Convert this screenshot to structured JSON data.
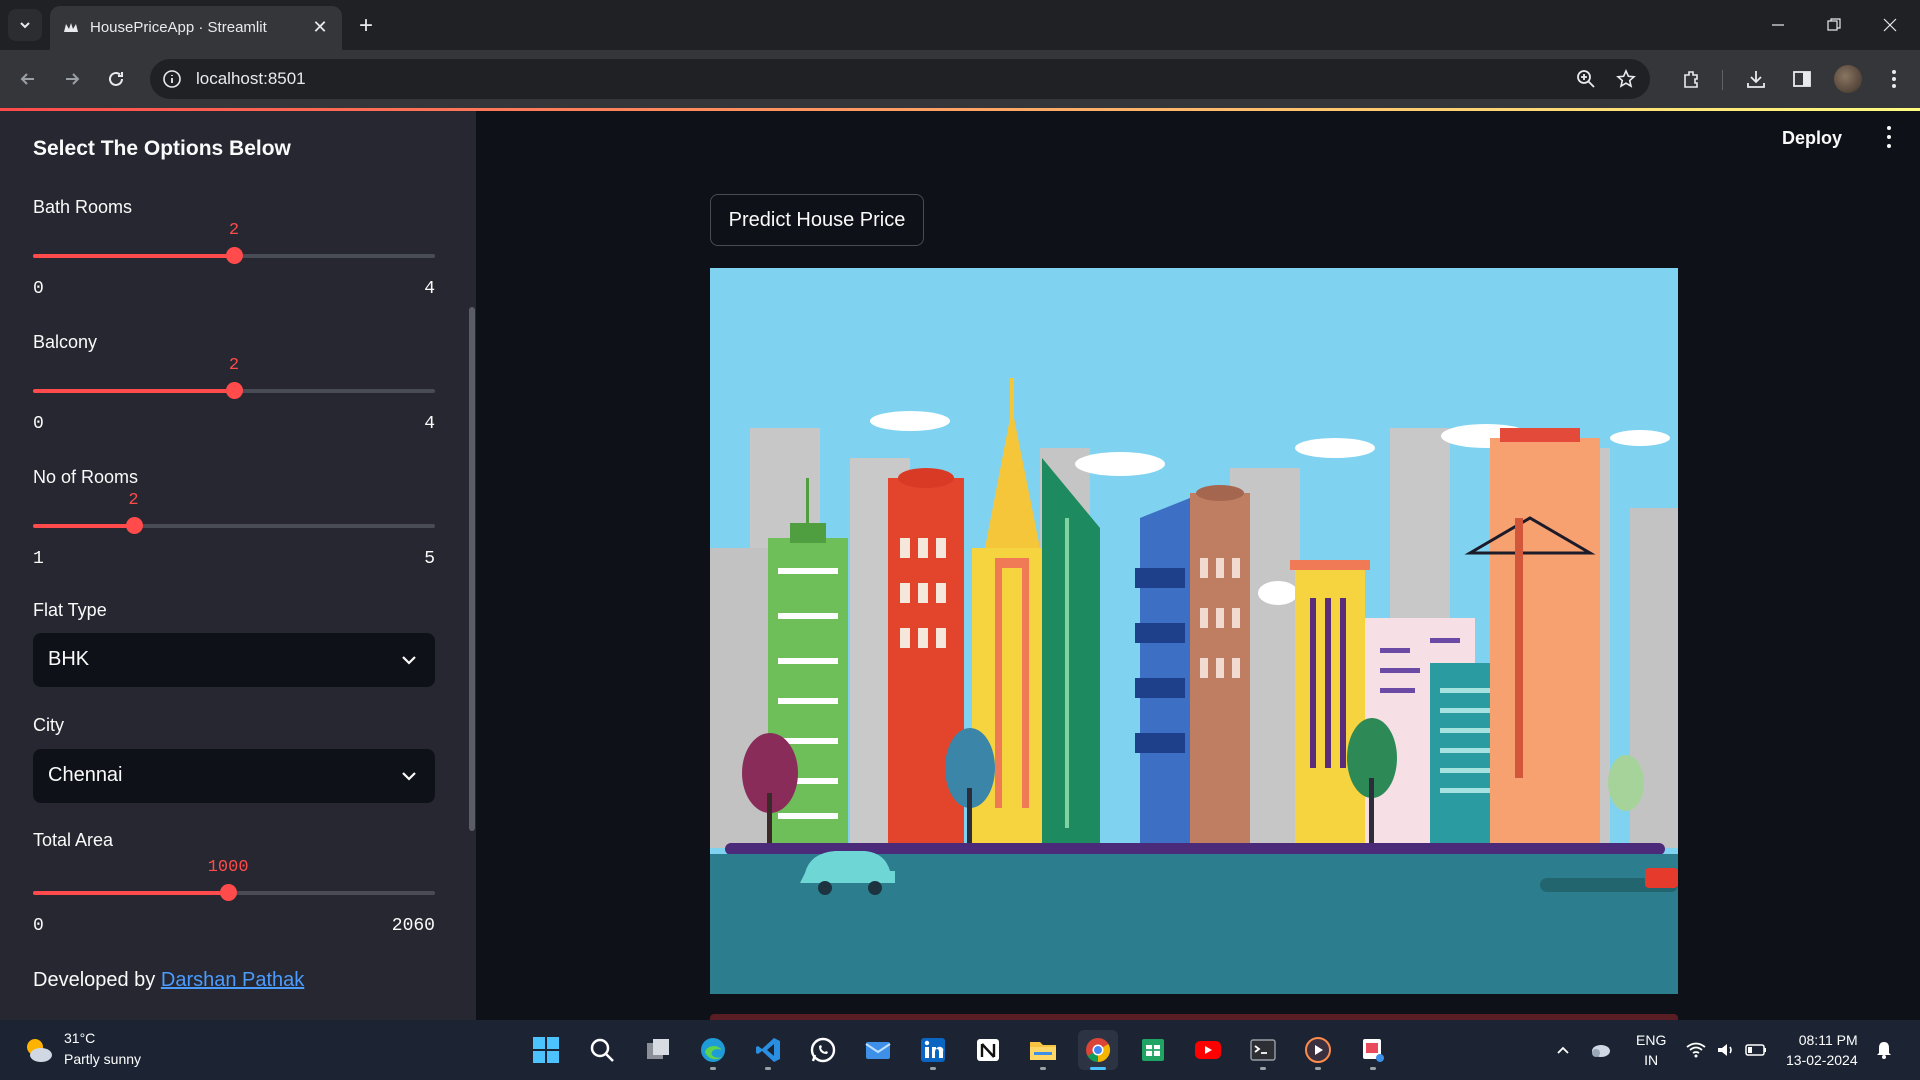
{
  "browser": {
    "tab_title": "HousePriceApp · Streamlit",
    "url": "localhost:8501"
  },
  "app": {
    "deploy_label": "Deploy",
    "predict_button": "Predict House Price"
  },
  "sidebar": {
    "header": "Select The Options Below",
    "bath_rooms": {
      "label": "Bath Rooms",
      "value": 2,
      "value_text": "2",
      "min": 0,
      "min_text": "0",
      "max": 4,
      "max_text": "4"
    },
    "balcony": {
      "label": "Balcony",
      "value": 2,
      "value_text": "2",
      "min": 0,
      "min_text": "0",
      "max": 4,
      "max_text": "4"
    },
    "rooms": {
      "label": "No of Rooms",
      "value": 2,
      "value_text": "2",
      "min": 1,
      "min_text": "1",
      "max": 5,
      "max_text": "5"
    },
    "flat_type": {
      "label": "Flat Type",
      "selected": "BHK"
    },
    "city": {
      "label": "City",
      "selected": "Chennai"
    },
    "total_area": {
      "label": "Total Area",
      "value": 1000,
      "value_text": "1000",
      "min": 0,
      "min_text": "0",
      "max": 2060,
      "max_text": "2060"
    },
    "developed_by": "Developed by",
    "developer_name": "Darshan Pathak"
  },
  "taskbar": {
    "weather_temp": "31°C",
    "weather_desc": "Partly sunny",
    "lang_top": "ENG",
    "lang_bottom": "IN",
    "time": "08:11 PM",
    "date": "13-02-2024",
    "apps": [
      "windows-start-icon",
      "search-icon",
      "task-view-icon",
      "edge-icon",
      "vscode-icon",
      "whatsapp-icon",
      "mail-icon",
      "linkedin-icon",
      "notion-icon",
      "file-explorer-icon",
      "chrome-icon",
      "sheets-icon",
      "youtube-icon",
      "terminal-icon",
      "media-player-icon",
      "snipping-tool-icon"
    ]
  },
  "colors": {
    "accent": "#ff4b4b",
    "sidebar_bg": "#262730",
    "main_bg": "#0e1117",
    "link": "#4a9cff"
  }
}
